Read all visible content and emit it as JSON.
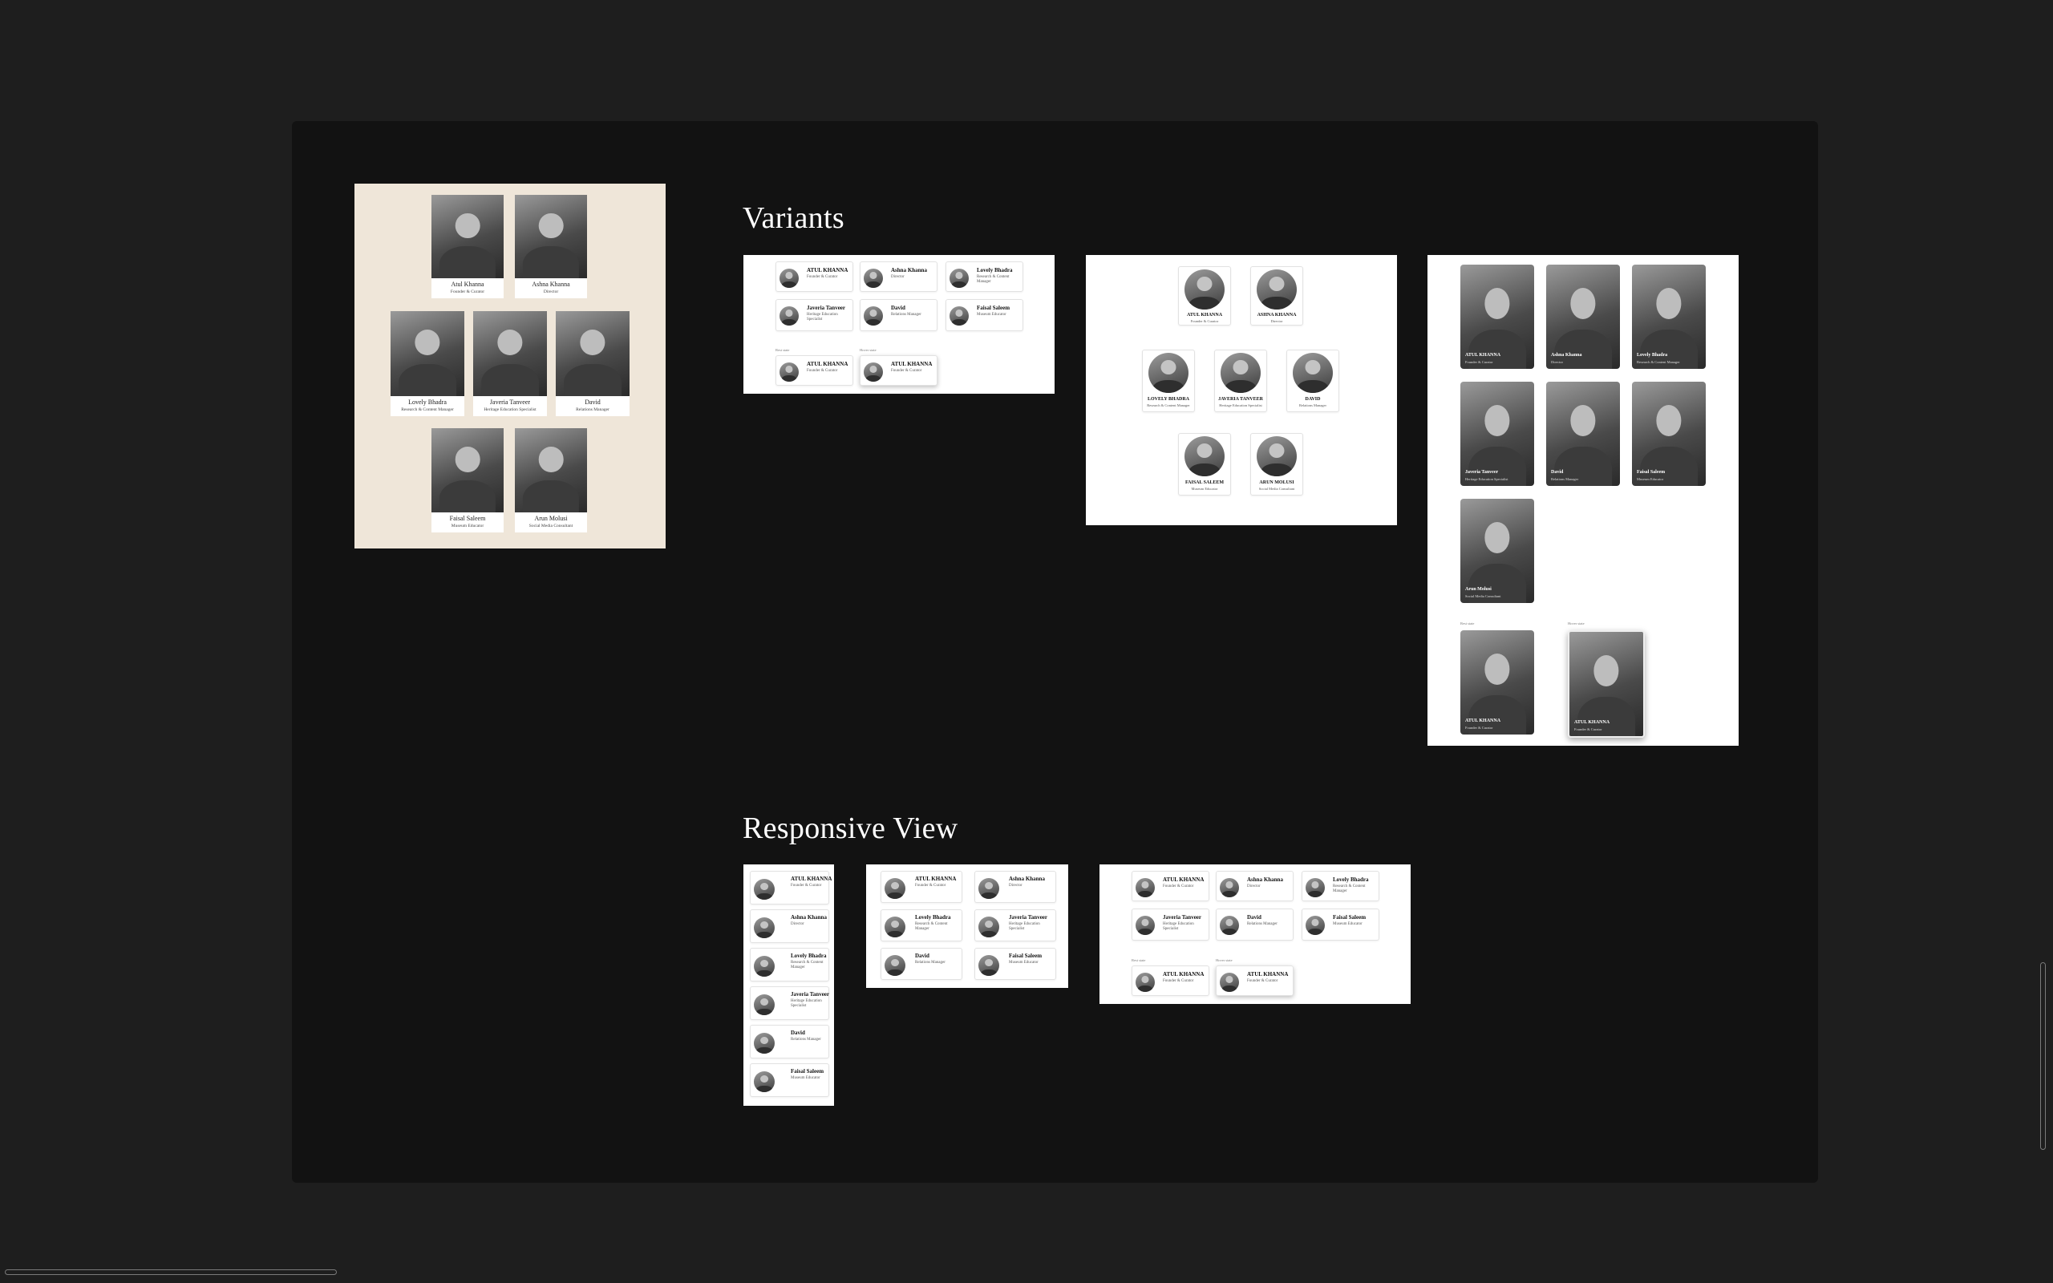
{
  "sections": {
    "variants_title": "Variants",
    "responsive_title": "Responsive View"
  },
  "team": [
    {
      "name": "Atul Khanna",
      "name_caps": "ATUL KHANNA",
      "role": "Founder & Curator"
    },
    {
      "name": "Ashna Khanna",
      "name_caps": "ASHNA KHANNA",
      "role": "Director"
    },
    {
      "name": "Lovely Bhadra",
      "name_caps": "LOVELY BHADRA",
      "role": "Research & Content Manager"
    },
    {
      "name": "Javeria Tanveer",
      "name_caps": "JAVERIA TANVEER",
      "role": "Heritage Education Specialist"
    },
    {
      "name": "David",
      "name_caps": "DAVID",
      "role": "Relations Manager"
    },
    {
      "name": "Faisal Saleem",
      "name_caps": "FAISAL SALEEM",
      "role": "Museum Educator"
    },
    {
      "name": "Arun Molusi",
      "name_caps": "ARUN MOLUSI",
      "role": "Social Media Consultant"
    }
  ],
  "list_variant": [
    {
      "name": "ATUL KHANNA",
      "role": "Founder & Curator"
    },
    {
      "name": "Ashna Khanna",
      "role": "Director"
    },
    {
      "name": "Lovely Bhadra",
      "role": "Research & Content Manager"
    },
    {
      "name": "Javeria Tanveer",
      "role": "Heritage Education Specialist"
    },
    {
      "name": "David",
      "role": "Relations Manager"
    },
    {
      "name": "Faisal Saleem",
      "role": "Museum Educator"
    }
  ],
  "states": {
    "rest": "Rest state",
    "hover": "Hover state"
  }
}
